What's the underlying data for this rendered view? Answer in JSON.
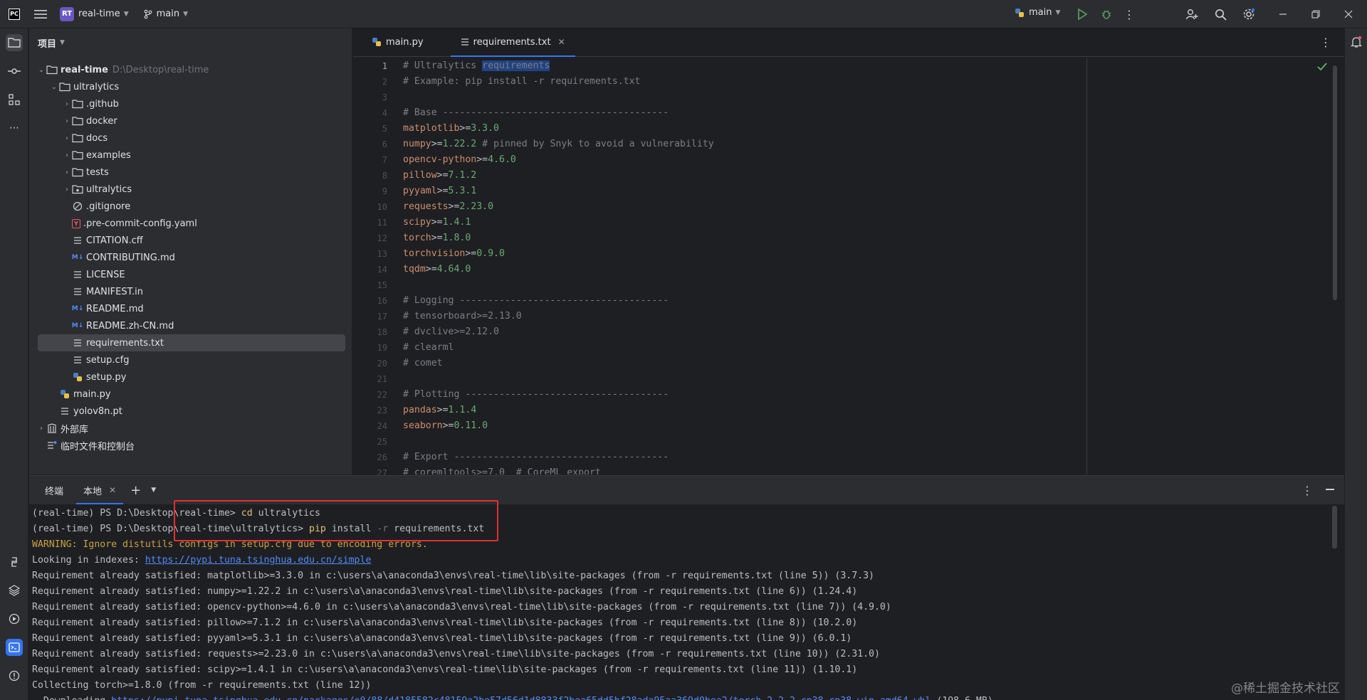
{
  "titlebar": {
    "app_logo": "PC",
    "project_badge": "RT",
    "project_name": "real-time",
    "branch": "main",
    "run_config": "main"
  },
  "project_panel": {
    "title": "项目",
    "tree": [
      {
        "label": "real-time",
        "path": "D:\\Desktop\\real-time",
        "type": "folder",
        "expanded": true
      },
      {
        "label": "ultralytics",
        "type": "folder",
        "expanded": true
      },
      {
        "label": ".github",
        "type": "folder"
      },
      {
        "label": "docker",
        "type": "folder"
      },
      {
        "label": "docs",
        "type": "folder"
      },
      {
        "label": "examples",
        "type": "folder"
      },
      {
        "label": "tests",
        "type": "folder"
      },
      {
        "label": "ultralytics",
        "type": "package"
      },
      {
        "label": ".gitignore",
        "type": "ignore"
      },
      {
        "label": ".pre-commit-config.yaml",
        "type": "yaml"
      },
      {
        "label": "CITATION.cff",
        "type": "text"
      },
      {
        "label": "CONTRIBUTING.md",
        "type": "markdown"
      },
      {
        "label": "LICENSE",
        "type": "text"
      },
      {
        "label": "MANIFEST.in",
        "type": "text"
      },
      {
        "label": "README.md",
        "type": "markdown"
      },
      {
        "label": "README.zh-CN.md",
        "type": "markdown"
      },
      {
        "label": "requirements.txt",
        "type": "text",
        "selected": true
      },
      {
        "label": "setup.cfg",
        "type": "text"
      },
      {
        "label": "setup.py",
        "type": "python"
      },
      {
        "label": "main.py",
        "type": "python"
      },
      {
        "label": "yolov8n.pt",
        "type": "text"
      },
      {
        "label": "外部库",
        "type": "library"
      },
      {
        "label": "临时文件和控制台",
        "type": "scratch"
      }
    ]
  },
  "editor": {
    "tabs": [
      {
        "label": "main.py",
        "active": false
      },
      {
        "label": "requirements.txt",
        "active": true
      }
    ],
    "lines": [
      "# Ultralytics requirements",
      "# Example: pip install -r requirements.txt",
      "",
      "# Base ----------------------------------------",
      "matplotlib>=3.3.0",
      "numpy>=1.22.2 # pinned by Snyk to avoid a vulnerability",
      "opencv-python>=4.6.0",
      "pillow>=7.1.2",
      "pyyaml>=5.3.1",
      "requests>=2.23.0",
      "scipy>=1.4.1",
      "torch>=1.8.0",
      "torchvision>=0.9.0",
      "tqdm>=4.64.0",
      "",
      "# Logging -------------------------------------",
      "# tensorboard>=2.13.0",
      "# dvclive>=2.12.0",
      "# clearml",
      "# comet",
      "",
      "# Plotting ------------------------------------",
      "pandas>=1.1.4",
      "seaborn>=0.11.0",
      "",
      "# Export --------------------------------------",
      "# coremltools>=7.0  # CoreML export"
    ],
    "line_numbers": [
      "1",
      "2",
      "3",
      "4",
      "5",
      "6",
      "7",
      "8",
      "9",
      "10",
      "11",
      "12",
      "13",
      "14",
      "15",
      "16",
      "17",
      "18",
      "19",
      "20",
      "21",
      "22",
      "23",
      "24",
      "25",
      "26",
      "27"
    ]
  },
  "terminal": {
    "tabs": [
      "终端",
      "本地"
    ],
    "lines": [
      "(real-time) PS D:\\Desktop\\real-time> cd ultralytics",
      "(real-time) PS D:\\Desktop\\real-time\\ultralytics> pip install -r requirements.txt",
      "WARNING: Ignore distutils configs in setup.cfg due to encoding errors.",
      "Looking in indexes: https://pypi.tuna.tsinghua.edu.cn/simple",
      "Requirement already satisfied: matplotlib>=3.3.0 in c:\\users\\a\\anaconda3\\envs\\real-time\\lib\\site-packages (from -r requirements.txt (line 5)) (3.7.3)",
      "Requirement already satisfied: numpy>=1.22.2 in c:\\users\\a\\anaconda3\\envs\\real-time\\lib\\site-packages (from -r requirements.txt (line 6)) (1.24.4)",
      "Requirement already satisfied: opencv-python>=4.6.0 in c:\\users\\a\\anaconda3\\envs\\real-time\\lib\\site-packages (from -r requirements.txt (line 7)) (4.9.0)",
      "Requirement already satisfied: pillow>=7.1.2 in c:\\users\\a\\anaconda3\\envs\\real-time\\lib\\site-packages (from -r requirements.txt (line 8)) (10.2.0)",
      "Requirement already satisfied: pyyaml>=5.3.1 in c:\\users\\a\\anaconda3\\envs\\real-time\\lib\\site-packages (from -r requirements.txt (line 9)) (6.0.1)",
      "Requirement already satisfied: requests>=2.23.0 in c:\\users\\a\\anaconda3\\envs\\real-time\\lib\\site-packages (from -r requirements.txt (line 10)) (2.31.0)",
      "Requirement already satisfied: scipy>=1.4.1 in c:\\users\\a\\anaconda3\\envs\\real-time\\lib\\site-packages (from -r requirements.txt (line 11)) (1.10.1)",
      "Collecting torch>=1.8.0 (from -r requirements.txt (line 12))",
      "  Downloading https://pypi.tuna.tsinghua.edu.cn/packages/e0/88/d4185582c48159a2be57d56d1d8833f2bea65dd5bf28ada95aa369d0bea2/torch-2.2.2-cp38-cp38-win_amd64.whl (198.6 MB)"
    ]
  },
  "watermark": "@稀土掘金技术社区",
  "colors": {
    "accent": "#3574f0",
    "highlight_box": "#e03131",
    "string_value": "#6aab73",
    "keyword": "#cf8e6d"
  }
}
